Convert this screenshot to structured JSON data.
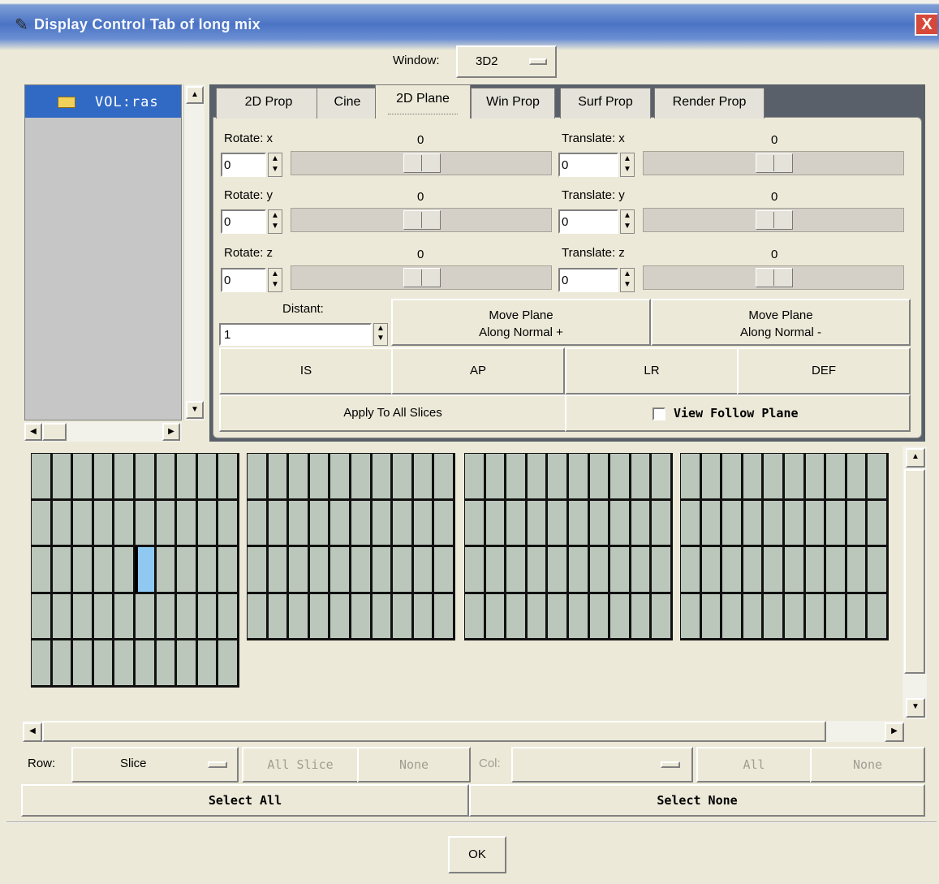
{
  "window": {
    "title": "Display Control Tab of long mix",
    "close_glyph": "X"
  },
  "top": {
    "window_label": "Window:",
    "window_value": "3D2"
  },
  "tree": {
    "item_label": "VOL:ras"
  },
  "tabs": [
    {
      "label": "2D Prop"
    },
    {
      "label": "Cine"
    },
    {
      "label": "2D Plane"
    },
    {
      "label": "Win Prop"
    },
    {
      "label": "Surf Prop"
    },
    {
      "label": "Render Prop"
    }
  ],
  "plane": {
    "rotate_x": {
      "label": "Rotate: x",
      "value": "0",
      "readout": "0"
    },
    "rotate_y": {
      "label": "Rotate: y",
      "value": "0",
      "readout": "0"
    },
    "rotate_z": {
      "label": "Rotate: z",
      "value": "0",
      "readout": "0"
    },
    "translate_x": {
      "label": "Translate: x",
      "value": "0",
      "readout": "0"
    },
    "translate_y": {
      "label": "Translate: y",
      "value": "0",
      "readout": "0"
    },
    "translate_z": {
      "label": "Translate: z",
      "value": "0",
      "readout": "0"
    },
    "distant_label": "Distant:",
    "distant_value": "1",
    "move_plus_line1": "Move Plane",
    "move_plus_line2": "Along Normal +",
    "move_minus_line1": "Move Plane",
    "move_minus_line2": "Along Normal -",
    "btn_is": "IS",
    "btn_ap": "AP",
    "btn_lr": "LR",
    "btn_def": "DEF",
    "apply_all": "Apply To All Slices",
    "view_follow": "View Follow Plane",
    "view_follow_checked": false
  },
  "bottom": {
    "row_label": "Row:",
    "row_value": "Slice",
    "all_slice": "All Slice",
    "none_left": "None",
    "col_label": "Col:",
    "col_value": "",
    "all": "All",
    "none_right": "None",
    "select_all": "Select All",
    "select_none": "Select None",
    "ok": "OK"
  }
}
